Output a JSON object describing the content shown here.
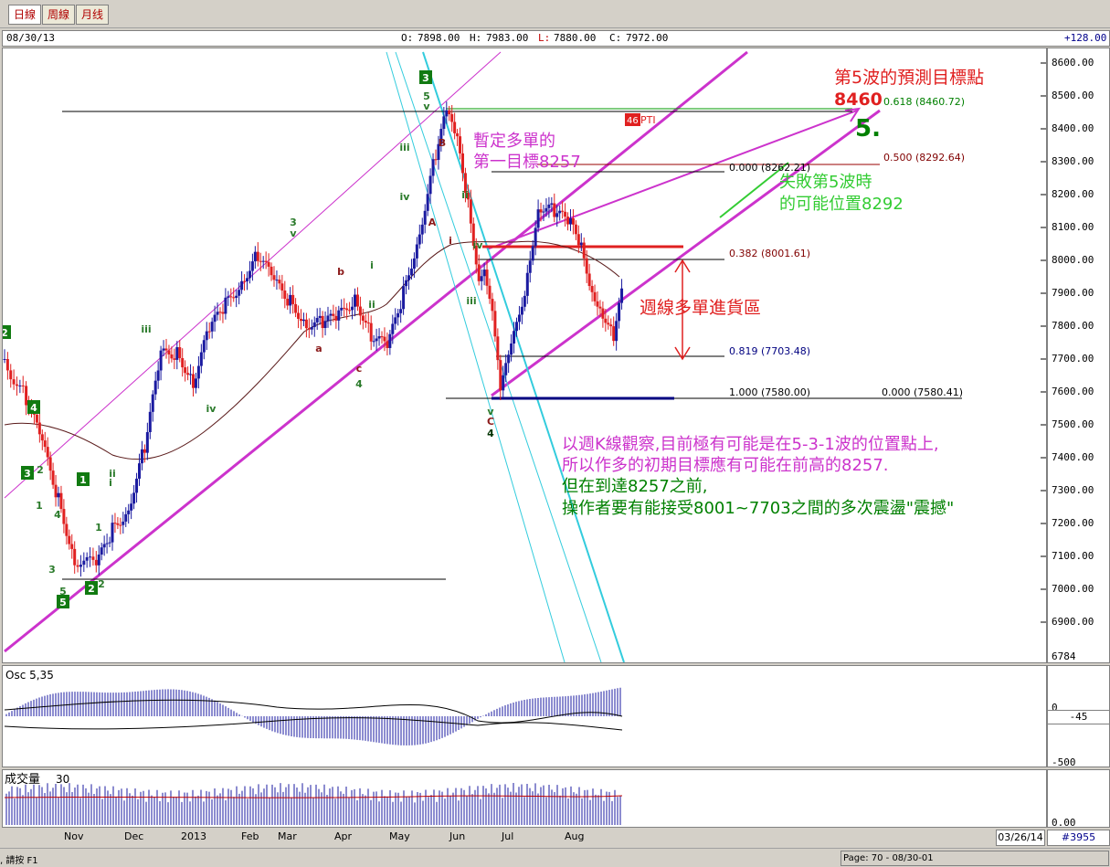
{
  "tabs": [
    "日線",
    "周線",
    "月线"
  ],
  "info_bar": {
    "date": "08/30/13",
    "open_label": "O:",
    "open": "7898.00",
    "high_label": "H:",
    "high": "7983.00",
    "low_label": "L:",
    "low": "7880.00",
    "close_label": "C:",
    "close": "7972.00",
    "change": "+128.00"
  },
  "chart_data": {
    "type": "candlestick",
    "price_ticks": [
      "8600.00",
      "8500.00",
      "8400.00",
      "8300.00",
      "8200.00",
      "8100.00",
      "8000.00",
      "7900.00",
      "7800.00",
      "7700.00",
      "7600.00",
      "7500.00",
      "7400.00",
      "7300.00",
      "7200.00",
      "7100.00",
      "7000.00",
      "6900.00",
      "6784"
    ],
    "x_labels": [
      "Nov",
      "Dec",
      "2013",
      "Feb",
      "Mar",
      "Apr",
      "May",
      "Jun",
      "Jul",
      "Aug"
    ],
    "fib_levels": [
      {
        "label": "0.000 (8262.21)",
        "value": 8262.21
      },
      {
        "label": "0.382 (8001.61)",
        "value": 8001.61
      },
      {
        "label": "0.819 (7703.48)",
        "value": 7703.48
      },
      {
        "label": "1.000 (7580.00)",
        "value": 7580.0
      }
    ],
    "fib_extensions": [
      {
        "label": "0.618 (8460.72)",
        "value": 8460.72
      },
      {
        "label": "0.500 (8292.64)",
        "value": 8292.64
      },
      {
        "label": "0.000 (7580.41)",
        "value": 7580.41
      }
    ],
    "close_path": [
      [
        0,
        7700
      ],
      [
        8,
        7580
      ],
      [
        14,
        7430
      ],
      [
        20,
        7280
      ],
      [
        26,
        7100
      ],
      [
        34,
        7060
      ],
      [
        40,
        7180
      ],
      [
        46,
        7260
      ],
      [
        52,
        7430
      ],
      [
        58,
        7700
      ],
      [
        64,
        7730
      ],
      [
        70,
        7640
      ],
      [
        76,
        7780
      ],
      [
        82,
        7860
      ],
      [
        88,
        7950
      ],
      [
        94,
        8020
      ],
      [
        100,
        7920
      ],
      [
        106,
        7880
      ],
      [
        112,
        7820
      ],
      [
        118,
        7800
      ],
      [
        124,
        7820
      ],
      [
        130,
        7900
      ],
      [
        136,
        7780
      ],
      [
        142,
        7720
      ],
      [
        148,
        7900
      ],
      [
        154,
        8100
      ],
      [
        160,
        8320
      ],
      [
        164,
        8440
      ],
      [
        168,
        8350
      ],
      [
        172,
        8180
      ],
      [
        176,
        7960
      ],
      [
        178,
        8000
      ],
      [
        182,
        7780
      ],
      [
        184,
        7600
      ],
      [
        188,
        7720
      ],
      [
        194,
        7960
      ],
      [
        198,
        8180
      ],
      [
        204,
        8140
      ],
      [
        210,
        8100
      ],
      [
        214,
        8040
      ],
      [
        218,
        7920
      ],
      [
        222,
        7850
      ],
      [
        226,
        7760
      ],
      [
        230,
        7930
      ]
    ],
    "osc_label": "Osc 5,35",
    "osc_value": "-45",
    "osc_ticks": [
      "0",
      "-500"
    ],
    "volume_label": "成交量",
    "volume_period": "30",
    "volume_tick": "0.00"
  },
  "wave_labels": [
    {
      "text": "3",
      "box": true
    },
    {
      "text": "5",
      "box": true
    },
    {
      "text": "2",
      "box": true
    },
    {
      "text": "1",
      "box": true
    },
    {
      "text": "4",
      "box": true
    },
    {
      "text": "2",
      "box": true
    },
    {
      "text": "3",
      "box": true
    },
    {
      "text": "iii"
    },
    {
      "text": "iv"
    },
    {
      "text": "v"
    },
    {
      "text": "3"
    },
    {
      "text": "a"
    },
    {
      "text": "b"
    },
    {
      "text": "c"
    },
    {
      "text": "4"
    },
    {
      "text": "i"
    },
    {
      "text": "ii"
    },
    {
      "text": "iii"
    },
    {
      "text": "iv"
    },
    {
      "text": "v"
    },
    {
      "text": "5"
    },
    {
      "text": "A"
    },
    {
      "text": "B"
    },
    {
      "text": "i"
    },
    {
      "text": "ii"
    },
    {
      "text": "iii"
    },
    {
      "text": "iv"
    },
    {
      "text": "v"
    },
    {
      "text": "C"
    },
    {
      "text": "4"
    },
    {
      "text": "2"
    },
    {
      "text": "1"
    },
    {
      "text": "4"
    },
    {
      "text": "3"
    },
    {
      "text": "5"
    },
    {
      "text": "1"
    },
    {
      "text": "i"
    },
    {
      "text": "ii"
    },
    {
      "text": "2"
    }
  ],
  "annotations": {
    "target_title": "第5波的預測目標點",
    "target_value": "8460",
    "wave5_label": "5.",
    "pti_number": "46",
    "pti_text": "PTI",
    "temp_target_line1": "暫定多單的",
    "temp_target_line2": "第一目標8257",
    "fail_line1": "失敗第5波時",
    "fail_line2": "的可能位置8292",
    "weekly_zone": "週線多單進貨區",
    "comment1": "以週K線觀察,目前極有可能是在5-3-1波的位置點上,",
    "comment2": "所以作多的初期目標應有可能在前高的8257.",
    "comment3": "但在到達8257之前,",
    "comment4": "操作者要有能接受8001~7703之間的多次震盪\"震撼\""
  },
  "date_box": "03/26/14",
  "bar_count": "#3955",
  "status": {
    "left": ", 請按 F1",
    "page": "Page: 70 - 08/30-01"
  }
}
